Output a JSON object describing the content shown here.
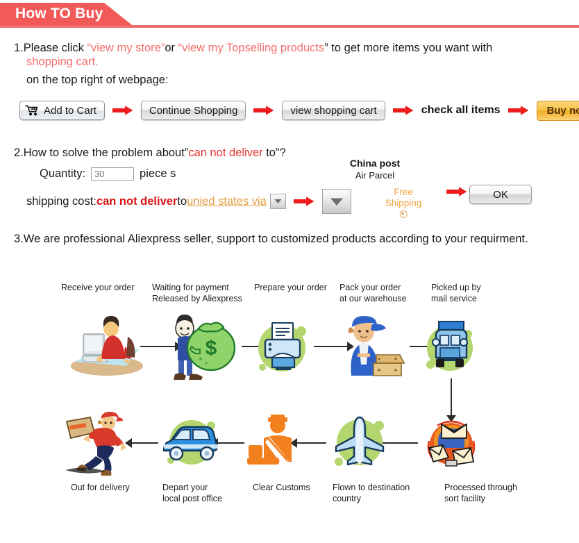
{
  "header": {
    "title": "How TO Buy",
    "accent_color": "#f25a5a",
    "rule_color": "#f06a6a"
  },
  "step1": {
    "number": "1.",
    "lead": "Please click ",
    "quote_open": "“",
    "link1": "view my store",
    "quote_close": "”",
    "mid": "or ",
    "link2": "view my Topselling products",
    "tail": " to get more items you want with",
    "link3": "shopping cart.",
    "line3": "on the top right of webpage:",
    "buttons": {
      "add_to_cart": "Add to Cart",
      "continue_shopping": "Continue Shopping",
      "view_shopping_cart": "view shopping cart",
      "check_all_items": "check all items",
      "buy_now": "Buy now"
    },
    "icons": {
      "cart": "shopping-cart-icon",
      "arrow": "red-arrow-right-icon"
    }
  },
  "step2": {
    "number": "2.",
    "line1_a": "How to solve the problem about”",
    "line1_red": "can not deliver",
    "line1_b": " to”?",
    "quantity_label": "Quantity:",
    "quantity_value": "30",
    "quantity_placeholder": "30",
    "piece_label": "piece s",
    "shipping_label": "shipping cost:",
    "shipping_red": "can not deliver",
    "shipping_to": " to ",
    "destination": "unied states via",
    "carrier_title": "China post",
    "carrier_sub": "Air Parcel",
    "free_shipping_l1": "Free",
    "free_shipping_l2": "Shipping",
    "ok_label": "OK"
  },
  "step3": {
    "text": "3.We are professional Aliexpress seller, support to customized products according to your requirment."
  },
  "flow": {
    "top_row": [
      {
        "label_l1": "Receive your order",
        "label_l2": "",
        "icon": "person-at-computer-icon"
      },
      {
        "label_l1": "Waiting for payment",
        "label_l2": "Released by Aliexpress",
        "icon": "money-bag-icon"
      },
      {
        "label_l1": "Prepare your order",
        "label_l2": "",
        "icon": "printer-icon"
      },
      {
        "label_l1": "Pack your order",
        "label_l2": "at our warehouse",
        "icon": "worker-with-boxes-icon"
      },
      {
        "label_l1": "Picked up by",
        "label_l2": "mail service",
        "icon": "delivery-truck-icon"
      }
    ],
    "bottom_row": [
      {
        "label_l1": "Out for delivery",
        "label_l2": "",
        "icon": "courier-running-icon"
      },
      {
        "label_l1": "Depart your",
        "label_l2": "local post office",
        "icon": "delivery-van-icon"
      },
      {
        "label_l1": "Clear Customs",
        "label_l2": "",
        "icon": "customs-officer-icon"
      },
      {
        "label_l1": "Flown to destination",
        "label_l2": "country",
        "icon": "airplane-icon"
      },
      {
        "label_l1": "Processed through",
        "label_l2": "sort facility",
        "icon": "mail-sorting-icon"
      }
    ]
  }
}
